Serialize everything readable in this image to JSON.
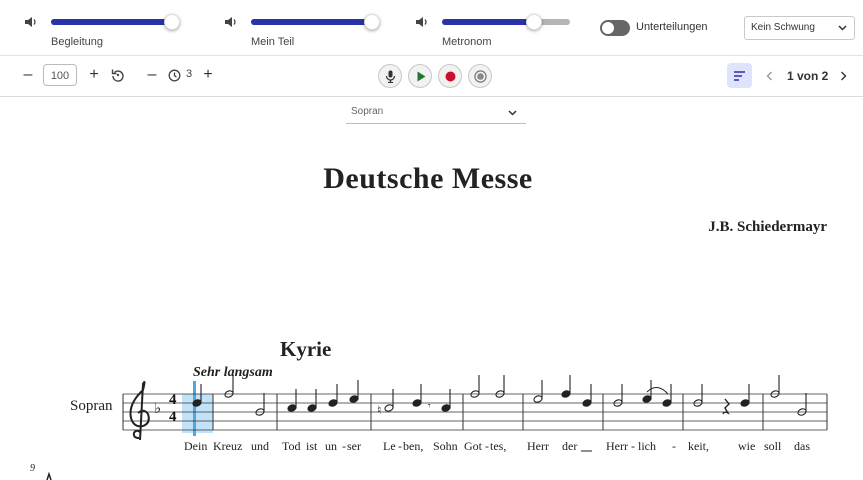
{
  "mixer": {
    "sliders": [
      {
        "label": "Begleitung",
        "level": 0.95
      },
      {
        "label": "Mein Teil",
        "level": 0.95
      },
      {
        "label": "Metronom",
        "level": 0.72
      }
    ],
    "subdivision_label": "Unterteilungen",
    "subdivision_on": false,
    "swing_select": "Kein Schwung"
  },
  "toolbar": {
    "zoom_value": "100",
    "count_in": "3",
    "page_indicator": "1 von 2",
    "record_color": "#c8102e",
    "play_color": "#1f7a2e"
  },
  "part_select": "Sopran",
  "score": {
    "title": "Deutsche Messe",
    "composer": "J.B. Schiedermayr",
    "section": "Kyrie",
    "tempo": "Sehr langsam",
    "staff_label": "Sopran",
    "time_sig_top": "4",
    "time_sig_bottom": "4",
    "next_system_measure": "9",
    "lyrics": [
      "Dein",
      "Kreuz",
      "und",
      "Tod",
      "ist",
      "un",
      "-",
      "ser",
      "Le",
      "-",
      "ben,",
      "Sohn",
      "Got",
      "-",
      "tes,",
      "Herr",
      "der",
      "Herr",
      "-",
      "lich",
      "-",
      "keit,",
      "wie",
      "soll",
      "das"
    ]
  }
}
